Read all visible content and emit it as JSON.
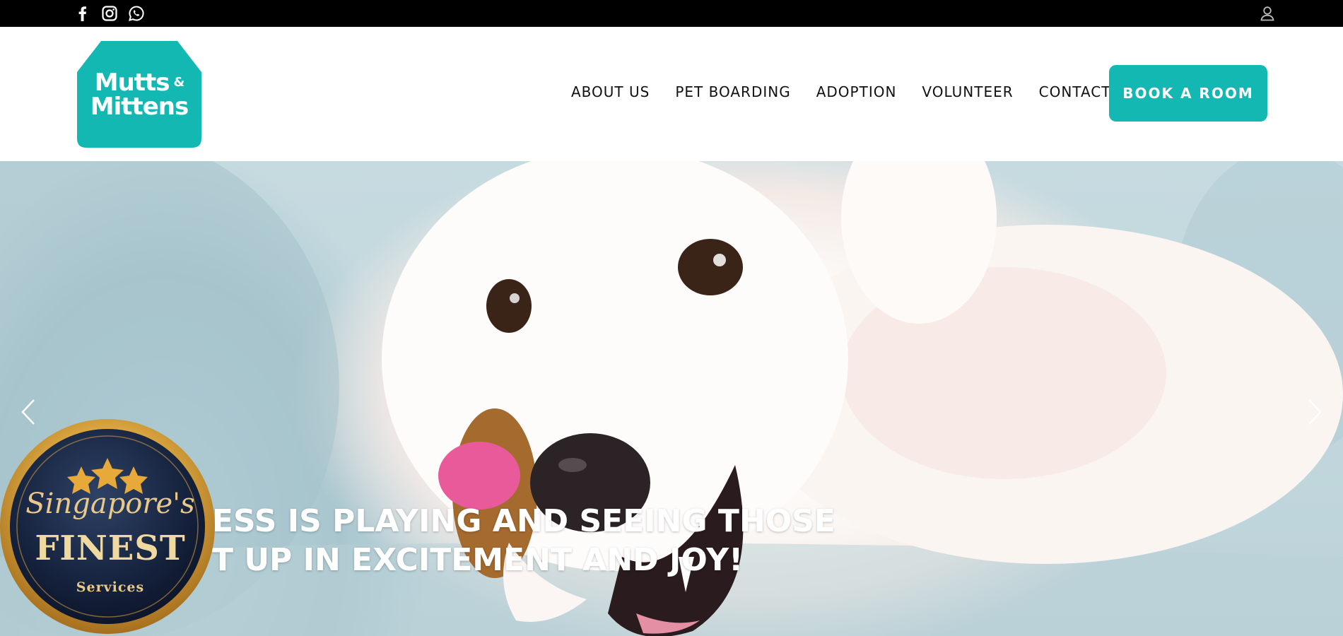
{
  "topbar": {
    "social_icons": [
      "facebook-icon",
      "instagram-icon",
      "whatsapp-icon"
    ],
    "account_icon": "user-icon"
  },
  "logo": {
    "line1": "Mutts",
    "amp": "&",
    "line2": "Mittens",
    "color": "#13b8b2"
  },
  "nav": {
    "items": [
      "ABOUT US",
      "PET BOARDING",
      "ADOPTION",
      "VOLUNTEER",
      "CONTACT US"
    ],
    "cta": "BOOK A ROOM"
  },
  "hero": {
    "caption_line1": "ESS IS PLAYING AND SEEING THOSE",
    "caption_line2": "T UP IN EXCITEMENT AND JOY!",
    "prev_icon": "chevron-left-icon",
    "next_icon": "chevron-right-icon"
  },
  "badge": {
    "script": "Singapore's",
    "title": "FINEST",
    "subtitle": "Services"
  },
  "colors": {
    "accent": "#13b8b2",
    "topbar": "#000000",
    "badge_navy": "#14203a",
    "badge_gold": "#d9a53f"
  }
}
